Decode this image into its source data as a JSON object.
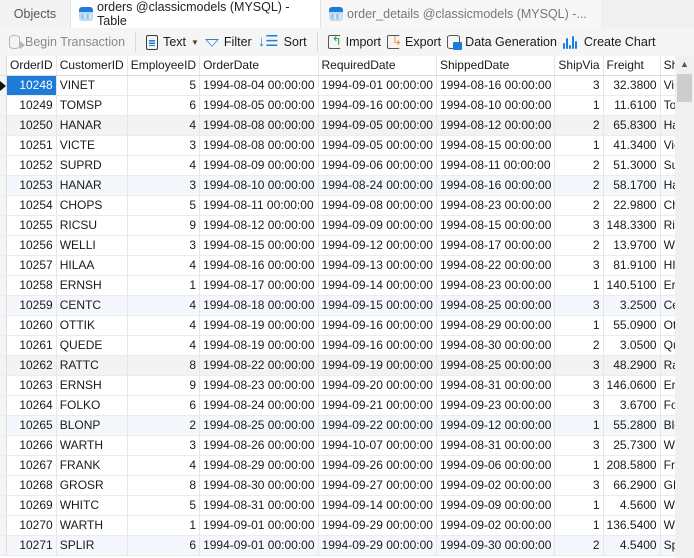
{
  "tabs": {
    "objects_label": "Objects",
    "active_label": "orders @classicmodels (MYSQL) - Table",
    "inactive_label": "order_details @classicmodels (MYSQL) -..."
  },
  "toolbar": {
    "begin_transaction": "Begin Transaction",
    "text": "Text",
    "filter": "Filter",
    "sort": "Sort",
    "import": "Import",
    "export": "Export",
    "data_generation": "Data Generation",
    "create_chart": "Create Chart"
  },
  "grid": {
    "columns": [
      "OrderID",
      "CustomerID",
      "EmployeeID",
      "OrderDate",
      "RequiredDate",
      "ShippedDate",
      "ShipVia",
      "Freight",
      "ShipName"
    ],
    "selected_row": 0,
    "rows": [
      [
        "10248",
        "VINET",
        "5",
        "1994-08-04 00:00:00",
        "1994-09-01 00:00:00",
        "1994-08-16 00:00:00",
        "3",
        "32.3800",
        "Vins et alcools Chevalier"
      ],
      [
        "10249",
        "TOMSP",
        "6",
        "1994-08-05 00:00:00",
        "1994-09-16 00:00:00",
        "1994-08-10 00:00:00",
        "1",
        "11.6100",
        "Toms Spezialitäten"
      ],
      [
        "10250",
        "HANAR",
        "4",
        "1994-08-08 00:00:00",
        "1994-09-05 00:00:00",
        "1994-08-12 00:00:00",
        "2",
        "65.8300",
        "Hanari Carnes"
      ],
      [
        "10251",
        "VICTE",
        "3",
        "1994-08-08 00:00:00",
        "1994-09-05 00:00:00",
        "1994-08-15 00:00:00",
        "1",
        "41.3400",
        "Victuailles en stock"
      ],
      [
        "10252",
        "SUPRD",
        "4",
        "1994-08-09 00:00:00",
        "1994-09-06 00:00:00",
        "1994-08-11 00:00:00",
        "2",
        "51.3000",
        "Suprêmes délices"
      ],
      [
        "10253",
        "HANAR",
        "3",
        "1994-08-10 00:00:00",
        "1994-08-24 00:00:00",
        "1994-08-16 00:00:00",
        "2",
        "58.1700",
        "Hanari Carnes"
      ],
      [
        "10254",
        "CHOPS",
        "5",
        "1994-08-11 00:00:00",
        "1994-09-08 00:00:00",
        "1994-08-23 00:00:00",
        "2",
        "22.9800",
        "Chop-suey Chinese"
      ],
      [
        "10255",
        "RICSU",
        "9",
        "1994-08-12 00:00:00",
        "1994-09-09 00:00:00",
        "1994-08-15 00:00:00",
        "3",
        "148.3300",
        "Richter Supermarkt"
      ],
      [
        "10256",
        "WELLI",
        "3",
        "1994-08-15 00:00:00",
        "1994-09-12 00:00:00",
        "1994-08-17 00:00:00",
        "2",
        "13.9700",
        "Wellington Importadora"
      ],
      [
        "10257",
        "HILAA",
        "4",
        "1994-08-16 00:00:00",
        "1994-09-13 00:00:00",
        "1994-08-22 00:00:00",
        "3",
        "81.9100",
        "HILARIÓN-Abastos"
      ],
      [
        "10258",
        "ERNSH",
        "1",
        "1994-08-17 00:00:00",
        "1994-09-14 00:00:00",
        "1994-08-23 00:00:00",
        "1",
        "140.5100",
        "Ernst Handel"
      ],
      [
        "10259",
        "CENTC",
        "4",
        "1994-08-18 00:00:00",
        "1994-09-15 00:00:00",
        "1994-08-25 00:00:00",
        "3",
        "3.2500",
        "Centro comercial"
      ],
      [
        "10260",
        "OTTIK",
        "4",
        "1994-08-19 00:00:00",
        "1994-09-16 00:00:00",
        "1994-08-29 00:00:00",
        "1",
        "55.0900",
        "Ottilies Käseladen"
      ],
      [
        "10261",
        "QUEDE",
        "4",
        "1994-08-19 00:00:00",
        "1994-09-16 00:00:00",
        "1994-08-30 00:00:00",
        "2",
        "3.0500",
        "Que Delícia"
      ],
      [
        "10262",
        "RATTC",
        "8",
        "1994-08-22 00:00:00",
        "1994-09-19 00:00:00",
        "1994-08-25 00:00:00",
        "3",
        "48.2900",
        "Rattlesnake Canyon"
      ],
      [
        "10263",
        "ERNSH",
        "9",
        "1994-08-23 00:00:00",
        "1994-09-20 00:00:00",
        "1994-08-31 00:00:00",
        "3",
        "146.0600",
        "Ernst Handel"
      ],
      [
        "10264",
        "FOLKO",
        "6",
        "1994-08-24 00:00:00",
        "1994-09-21 00:00:00",
        "1994-09-23 00:00:00",
        "3",
        "3.6700",
        "Folk och fä HB"
      ],
      [
        "10265",
        "BLONP",
        "2",
        "1994-08-25 00:00:00",
        "1994-09-22 00:00:00",
        "1994-09-12 00:00:00",
        "1",
        "55.2800",
        "Blondel père et fils"
      ],
      [
        "10266",
        "WARTH",
        "3",
        "1994-08-26 00:00:00",
        "1994-10-07 00:00:00",
        "1994-08-31 00:00:00",
        "3",
        "25.7300",
        "Wartian Herkku"
      ],
      [
        "10267",
        "FRANK",
        "4",
        "1994-08-29 00:00:00",
        "1994-09-26 00:00:00",
        "1994-09-06 00:00:00",
        "1",
        "208.5800",
        "Frankenversand"
      ],
      [
        "10268",
        "GROSR",
        "8",
        "1994-08-30 00:00:00",
        "1994-09-27 00:00:00",
        "1994-09-02 00:00:00",
        "3",
        "66.2900",
        "GROSELLA-Restaurante"
      ],
      [
        "10269",
        "WHITC",
        "5",
        "1994-08-31 00:00:00",
        "1994-09-14 00:00:00",
        "1994-09-09 00:00:00",
        "1",
        "4.5600",
        "White Clover Markets"
      ],
      [
        "10270",
        "WARTH",
        "1",
        "1994-09-01 00:00:00",
        "1994-09-29 00:00:00",
        "1994-09-02 00:00:00",
        "1",
        "136.5400",
        "Wartian Herkku"
      ],
      [
        "10271",
        "SPLIR",
        "6",
        "1994-09-01 00:00:00",
        "1994-09-29 00:00:00",
        "1994-09-30 00:00:00",
        "2",
        "4.5400",
        "Split Rail Beer & Ale"
      ]
    ]
  },
  "colors": {
    "selection": "#1e7bd8",
    "accent": "#1e7bd8"
  }
}
